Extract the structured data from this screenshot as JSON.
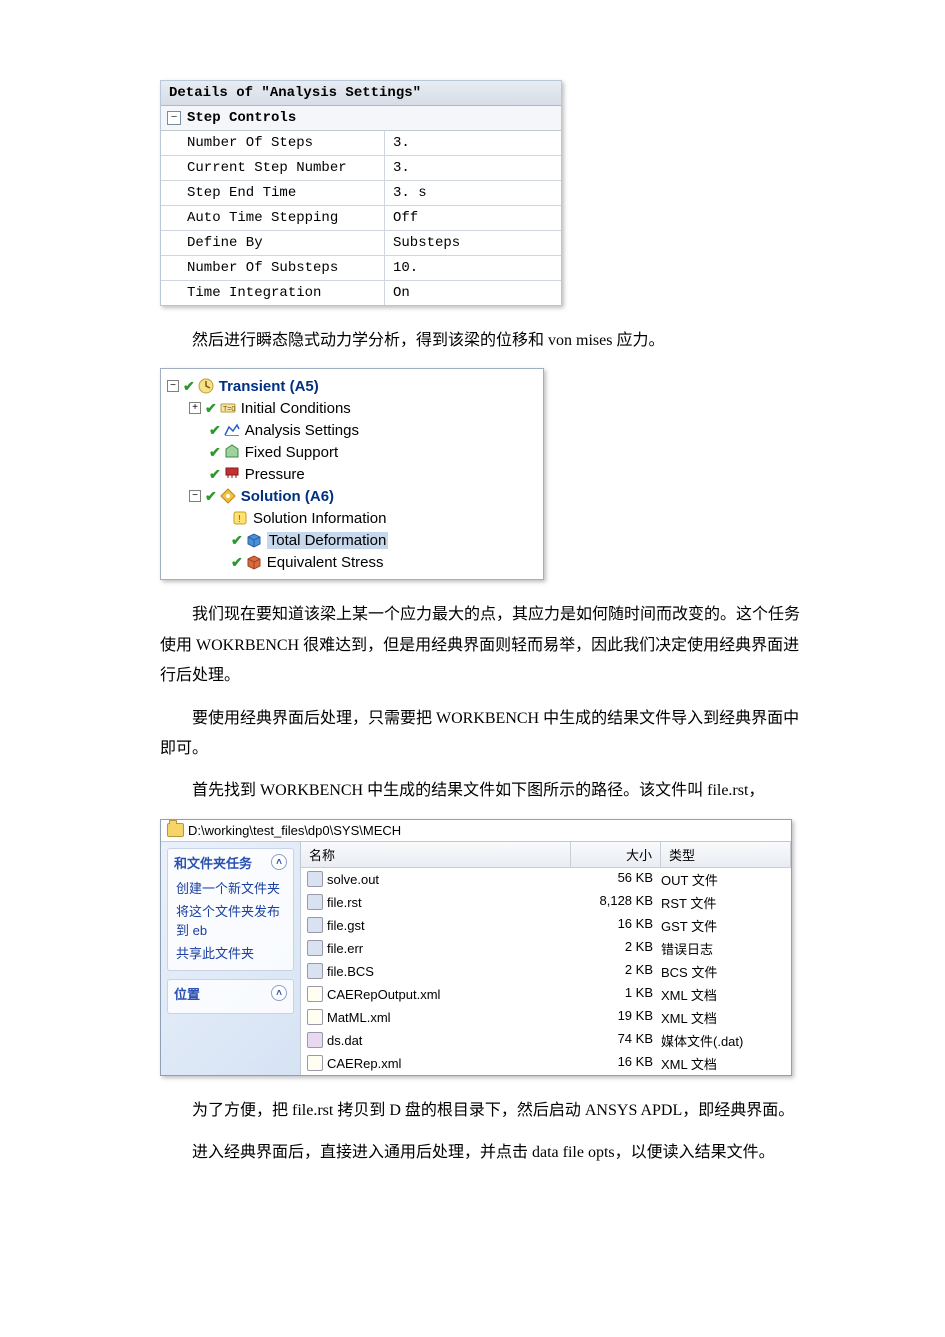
{
  "details": {
    "title": "Details of \"Analysis Settings\"",
    "group": "Step Controls",
    "rows": [
      {
        "label": "Number Of Steps",
        "value": "3."
      },
      {
        "label": "Current Step Number",
        "value": "3."
      },
      {
        "label": "Step End Time",
        "value": "3. s"
      },
      {
        "label": "Auto Time Stepping",
        "value": "Off"
      },
      {
        "label": "Define By",
        "value": "Substeps"
      },
      {
        "label": "Number Of Substeps",
        "value": "10."
      },
      {
        "label": "Time Integration",
        "value": "On"
      }
    ]
  },
  "para1": "然后进行瞬态隐式动力学分析，得到该梁的位移和 von mises 应力。",
  "tree": {
    "root": "Transient (A5)",
    "items": [
      "Initial Conditions",
      "Analysis Settings",
      "Fixed Support",
      "Pressure"
    ],
    "solution": "Solution (A6)",
    "sol_items": [
      "Solution Information",
      "Total Deformation",
      "Equivalent Stress"
    ]
  },
  "para2": "我们现在要知道该梁上某一个应力最大的点，其应力是如何随时间而改变的。这个任务使用 WOKRBENCH 很难达到，但是用经典界面则轻而易举，因此我们决定使用经典界面进行后处理。",
  "para3": "要使用经典界面后处理，只需要把 WORKBENCH 中生成的结果文件导入到经典界面中即可。",
  "para4": "首先找到 WORKBENCH 中生成的结果文件如下图所示的路径。该文件叫 file.rst，",
  "explorer": {
    "path": "D:\\working\\test_files\\dp0\\SYS\\MECH",
    "side_group1_header": "和文件夹任务",
    "side_links": [
      "创建一个新文件夹",
      "将这个文件夹发布到 eb",
      "共享此文件夹"
    ],
    "side_group2_header": "位置",
    "cols": {
      "name": "名称",
      "size": "大小",
      "type": "类型"
    },
    "files": [
      {
        "name": "solve.out",
        "size": "56 KB",
        "type": "OUT 文件",
        "ico": "sys"
      },
      {
        "name": "file.rst",
        "size": "8,128 KB",
        "type": "RST 文件",
        "ico": "sys"
      },
      {
        "name": "file.gst",
        "size": "16 KB",
        "type": "GST 文件",
        "ico": "sys"
      },
      {
        "name": "file.err",
        "size": "2 KB",
        "type": "错误日志",
        "ico": "sys"
      },
      {
        "name": "file.BCS",
        "size": "2 KB",
        "type": "BCS 文件",
        "ico": "sys"
      },
      {
        "name": "CAERepOutput.xml",
        "size": "1 KB",
        "type": "XML 文档",
        "ico": "xml"
      },
      {
        "name": "MatML.xml",
        "size": "19 KB",
        "type": "XML 文档",
        "ico": "xml"
      },
      {
        "name": "ds.dat",
        "size": "74 KB",
        "type": "媒体文件(.dat)",
        "ico": "dat"
      },
      {
        "name": "CAERep.xml",
        "size": "16 KB",
        "type": "XML 文档",
        "ico": "xml"
      }
    ]
  },
  "para5": "为了方便，把 file.rst 拷贝到 D 盘的根目录下，然后启动 ANSYS APDL，即经典界面。",
  "para6": "进入经典界面后，直接进入通用后处理，并点击 data file opts，以便读入结果文件。"
}
